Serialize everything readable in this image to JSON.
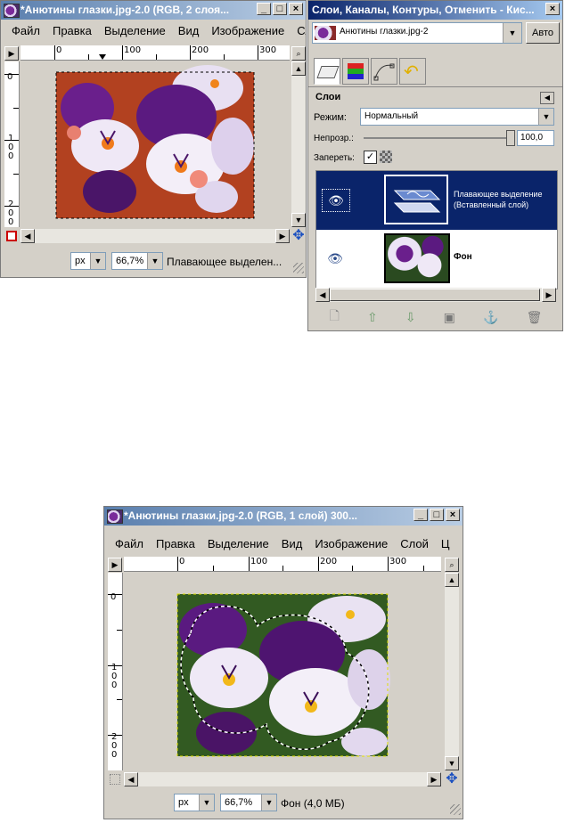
{
  "top_image_window": {
    "title": "*Анютины глазки.jpg-2.0 (RGB, 2 слоя...",
    "menu": [
      "Файл",
      "Правка",
      "Выделение",
      "Вид",
      "Изображение",
      "Сло"
    ],
    "ruler_h_labels": [
      "0",
      "100",
      "200",
      "300"
    ],
    "ruler_v_labels": [
      "0",
      "1\n0\n0",
      "2\n0\n0"
    ],
    "unit": "px",
    "zoom": "66,7%",
    "status": "Плавающее выделен..."
  },
  "layers_dialog": {
    "title": "Слои, Каналы, Контуры, Отменить - Кис...",
    "image_selector": "Анютины глазки.jpg-2",
    "auto_button": "Авто",
    "panel_title": "Слои",
    "mode_label": "Режим:",
    "mode_value": "Нормальный",
    "opacity_label": "Непрозр.:",
    "opacity_value": "100,0",
    "lock_label": "Запереть:",
    "layers": [
      {
        "name": "Плавающее выделение\n(Вставленный слой)",
        "selected": true
      },
      {
        "name": "Фон",
        "selected": false
      }
    ],
    "bottom_icons": [
      "new-layer-icon",
      "raise-layer-icon",
      "lower-layer-icon",
      "duplicate-layer-icon",
      "anchor-layer-icon",
      "delete-layer-icon"
    ]
  },
  "bottom_image_window": {
    "title": "*Анютины глазки.jpg-2.0 (RGB, 1 слой) 300...",
    "menu": [
      "Файл",
      "Правка",
      "Выделение",
      "Вид",
      "Изображение",
      "Слой",
      "Ц"
    ],
    "ruler_h_labels": [
      "0",
      "100",
      "200",
      "300"
    ],
    "ruler_v_labels": [
      "0",
      "1\n0\n0",
      "2\n0\n0"
    ],
    "unit": "px",
    "zoom": "66,7%",
    "status": "Фон (4,0 МБ)"
  },
  "colors": {
    "title_inactive": "#5a7fae",
    "title_active": "#0a246a",
    "selected_layer": "#0a246a",
    "window_face": "#d4d0c8"
  }
}
